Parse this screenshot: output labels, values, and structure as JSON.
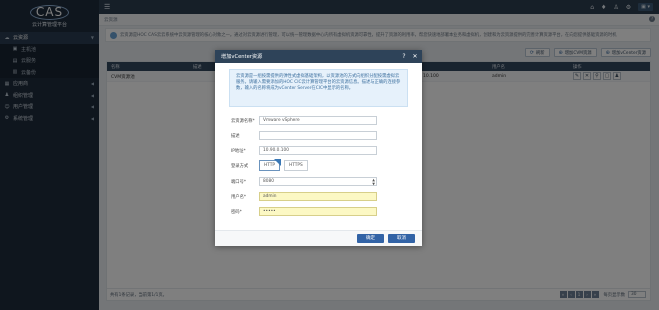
{
  "app": {
    "logo_mark": "CAS",
    "logo_sub": "云计算管理平台"
  },
  "sidebar": {
    "items": [
      {
        "label": "云资源",
        "icon": "cloud-icon",
        "glyph": "☁",
        "active": true
      },
      {
        "label": "主机池",
        "icon": "server-icon",
        "glyph": "▣"
      },
      {
        "label": "云服务",
        "icon": "service-icon",
        "glyph": "▤"
      },
      {
        "label": "云备份",
        "icon": "backup-icon",
        "glyph": "▥"
      },
      {
        "label": "应用商",
        "icon": "app-icon",
        "glyph": "▦"
      },
      {
        "label": "组织管理",
        "icon": "org-icon",
        "glyph": "♟"
      },
      {
        "label": "用户管理",
        "icon": "user-icon",
        "glyph": "☺"
      },
      {
        "label": "系统管理",
        "icon": "system-icon",
        "glyph": "⚙"
      }
    ]
  },
  "topbar": {
    "menu_glyph": "☰",
    "home_glyph": "⌂",
    "bell_glyph": "♦",
    "user_glyph": "♙",
    "gear_glyph": "⚙",
    "account_label": "▣ ▾"
  },
  "breadcrumb": {
    "text": "云资源"
  },
  "intro": {
    "text": "云资源是HOC CAS云云系统中云资源管理的核心对象之一。通过对云资源进行管理，可以统一管理数据中心内所有虚拟机资源可靠性，提升了资源的利用率，帮您快速地部署本业务和虚拟机，创建和为云资源提供的完善计算资源平台，在向您提供基础资源的时机"
  },
  "actions": {
    "refresh": "刷新",
    "add_cvm": "增加CVM资源",
    "add_vcenter": "增加vCenter资源"
  },
  "table": {
    "headers": [
      "名称",
      "描述",
      "IP地址",
      "用户名",
      "操作"
    ],
    "rows": [
      {
        "name": "CVM资源池",
        "desc": "",
        "ip": "10.100",
        "user": "admin"
      }
    ],
    "footer": "共有1条记录，当前第1/1页。",
    "per_page_label": "每页显示数",
    "per_page_value": "30"
  },
  "modal": {
    "title": "增加vCenter资源",
    "help_glyph": "?",
    "close_glyph": "✕",
    "tip": "云资源是一组按需提供的弹性式虚拟基础架构，以资源池的方式向组织分配按需虚拟云服务。请输入需要添加的HOC CIC云计算管理平台的云资源信息。描述与正确的连接参数，输入的名称将成为vCenter Server在CIC中显示的名称。",
    "fields": {
      "name_label": "云资源名称*",
      "name_value": "Vmware vSphere",
      "desc_label": "描述",
      "desc_value": "",
      "ip_label": "IP地址*",
      "ip_value": "10.90.0.100",
      "mode_label": "登录方式",
      "mode_http": "HTTP",
      "mode_https": "HTTPS",
      "port_label": "端口号*",
      "port_value": "8080",
      "user_label": "用户名*",
      "user_value": "admin",
      "pwd_label": "密码*",
      "pwd_value": "•••••"
    },
    "ok": "确定",
    "cancel": "取消"
  },
  "colors": {
    "sidebar": "#1f2d3d",
    "topbar": "#2c3e50",
    "primary": "#3263a6"
  }
}
